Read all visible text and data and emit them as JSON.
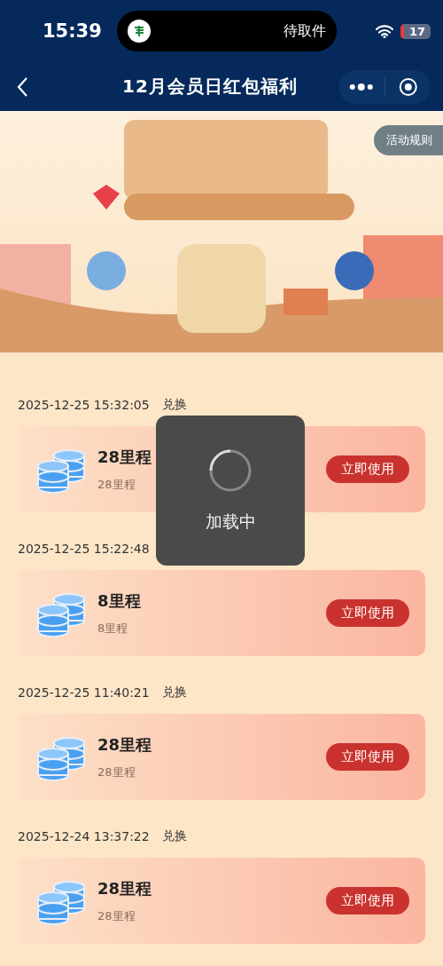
{
  "status_bar": {
    "time": "15:39",
    "island_text": "待取件",
    "battery": "17"
  },
  "nav": {
    "title": "12月会员日红包福利"
  },
  "banner": {
    "rules_button": "活动规则"
  },
  "records": [
    {
      "time": "2025-12-25 15:32:05",
      "action": "兑换",
      "title": "28里程",
      "subtitle": "28里程",
      "button": "立即使用"
    },
    {
      "time": "2025-12-25 15:22:48",
      "title": "8里程",
      "subtitle": "8里程",
      "button": "立即使用"
    },
    {
      "time": "2025-12-25 11:40:21",
      "action": "兑换",
      "title": "28里程",
      "subtitle": "28里程",
      "button": "立即使用"
    },
    {
      "time": "2025-12-24 13:37:22",
      "action": "兑换",
      "title": "28里程",
      "subtitle": "28里程",
      "button": "立即使用"
    }
  ],
  "loading_toast": {
    "text": "加载中"
  }
}
